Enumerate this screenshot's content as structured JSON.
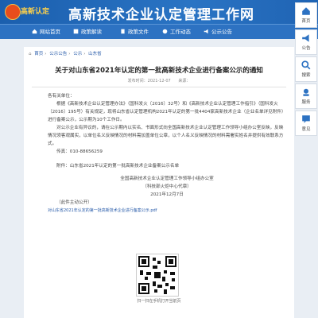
{
  "header": {
    "logo_text": "高新认定",
    "title": "高新技术企业认定管理工作网"
  },
  "nav": [
    {
      "icon": "home-icon",
      "label": "网站首页"
    },
    {
      "icon": "news-icon",
      "label": "政策解读"
    },
    {
      "icon": "doc-icon",
      "label": "政策文件"
    },
    {
      "icon": "work-icon",
      "label": "工作动态"
    },
    {
      "icon": "notice-icon",
      "label": "公示公告"
    }
  ],
  "sidebar": [
    {
      "icon": "home-icon",
      "label": "首页"
    },
    {
      "icon": "notice-icon",
      "label": "公告"
    },
    {
      "icon": "search-icon",
      "label": "搜索"
    },
    {
      "icon": "service-icon",
      "label": "服务"
    },
    {
      "icon": "feedback-icon",
      "label": "意见"
    }
  ],
  "breadcrumb": [
    "首页",
    "公示公告",
    "公示",
    "山东省"
  ],
  "article": {
    "title": "关于对山东省2021年认定的第一批高新技术企业进行备案公示的通知",
    "date": "发布时间：2021-12-07",
    "source": "来源：",
    "salutation": "各有关单位：",
    "para1": "根据《高新技术企业认定管理办法》（国科发火〔2016〕32号）和《高新技术企业认定管理工作指引》（国科发火〔2016〕195号）有关规定，现将山东省认定管理机构2021年认定的第一批4404家高新技术企业（企业名单详见附件）进行备案公示，公示期为10个工作日。",
    "para2": "对公示企业有异议的，请在公示期内以实名、书面形式向全国高新技术企业认定管理工作领导小组办公室反映，反映情况须客观属实，以单位名义反映情况的材料需加盖单位公章，以个人名义反映情况的材料需署实姓名并提供有效联系方式。",
    "phone": "传真：010-88656259",
    "attachment": "附件：山东省2021年认定的第一批高新技术企业备案公示名单",
    "sign_org": "全国高新技术企业认定管理工作领导小组办公室",
    "sign_org2": "（科技部火炬中心代章）",
    "sign_date": "2021年12月7日",
    "note": "（此件主动公开）",
    "file": "对山东省2021年认定的第一批高新技术企业进行备案公示.pdf",
    "qr_caption": "扫一扫在手机打开当前页"
  }
}
